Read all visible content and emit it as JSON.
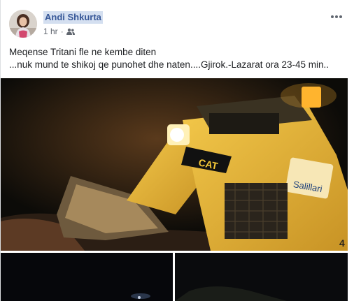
{
  "post": {
    "author": "Andi Shkurta",
    "time": "1 hr",
    "separator": "·",
    "audience_icon": "friends-icon",
    "more_icon": "more-options-icon",
    "lines": [
      "Meqense Tritani fle ne kembe diten",
      "...nuk mund te shikoj qe punohet dhe naten....Gjirok.-Lazarat ora 23-45 min.."
    ]
  },
  "photo": {
    "vehicle_brand": "CAT",
    "logo_text": "Salillari",
    "vehicle_number": "4"
  },
  "colors": {
    "link": "#385898",
    "meta": "#616770",
    "highlight": "#d4dff0"
  }
}
